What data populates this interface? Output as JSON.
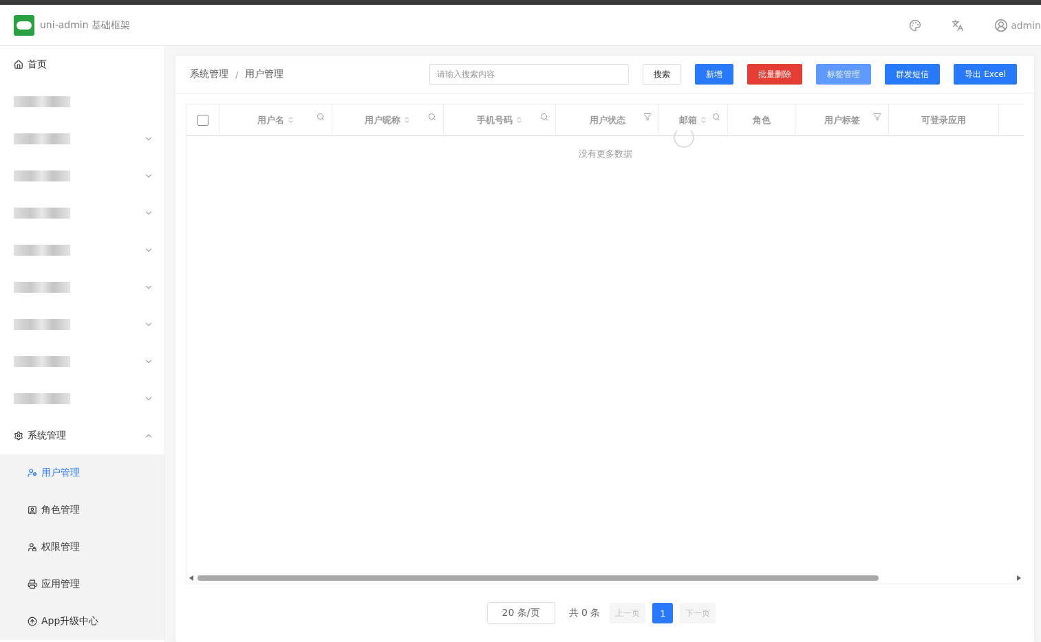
{
  "header": {
    "title": "uni-admin 基础框架",
    "user": "admin"
  },
  "sidebar": {
    "items": [
      {
        "kind": "link",
        "label": "首页"
      },
      {
        "kind": "redacted"
      },
      {
        "kind": "redacted",
        "expanded": false
      },
      {
        "kind": "redacted",
        "expanded": false
      },
      {
        "kind": "redacted",
        "expanded": false
      },
      {
        "kind": "redacted",
        "expanded": false
      },
      {
        "kind": "redacted",
        "expanded": false
      },
      {
        "kind": "redacted",
        "expanded": false
      },
      {
        "kind": "redacted",
        "expanded": false
      },
      {
        "kind": "redacted",
        "expanded": false
      },
      {
        "kind": "group",
        "label": "系统管理",
        "expanded": true,
        "children": [
          {
            "label": "用户管理",
            "selected": true
          },
          {
            "label": "角色管理",
            "selected": false
          },
          {
            "label": "权限管理",
            "selected": false
          },
          {
            "label": "应用管理",
            "selected": false
          },
          {
            "label": "App升级中心",
            "selected": false
          }
        ]
      }
    ]
  },
  "breadcrumb": {
    "items": [
      "系统管理",
      "用户管理"
    ],
    "separator": "/"
  },
  "search": {
    "placeholder": "请输入搜索内容"
  },
  "buttons": [
    {
      "label": "搜索",
      "kind": "plain",
      "disabled": false
    },
    {
      "label": "新增",
      "kind": "primary",
      "disabled": false
    },
    {
      "label": "批量删除",
      "kind": "danger",
      "disabled": false
    },
    {
      "label": "标签管理",
      "kind": "primary",
      "disabled": true
    },
    {
      "label": "群发短信",
      "kind": "primary",
      "disabled": false
    },
    {
      "label": "导出 Excel",
      "kind": "primary",
      "disabled": false
    }
  ],
  "table": {
    "loading": true,
    "checked": false,
    "empty_text": "没有更多数据",
    "columns": [
      {
        "label": "用户名",
        "sortable": true,
        "searchable": true
      },
      {
        "label": "用户昵称",
        "sortable": true,
        "searchable": true
      },
      {
        "label": "手机号码",
        "sortable": true,
        "searchable": true
      },
      {
        "label": "用户状态",
        "filterable": true
      },
      {
        "label": "邮箱",
        "sortable": true,
        "searchable": true
      },
      {
        "label": "角色"
      },
      {
        "label": "用户标签",
        "filterable": true
      },
      {
        "label": "可登录应用"
      }
    ]
  },
  "pagination": {
    "page_size": "20 条/页",
    "total": "共 0 条",
    "prev": {
      "label": "上一页",
      "disabled": true
    },
    "pages": [
      {
        "label": "1",
        "selected": true
      }
    ],
    "next": {
      "label": "下一页",
      "disabled": true
    }
  }
}
